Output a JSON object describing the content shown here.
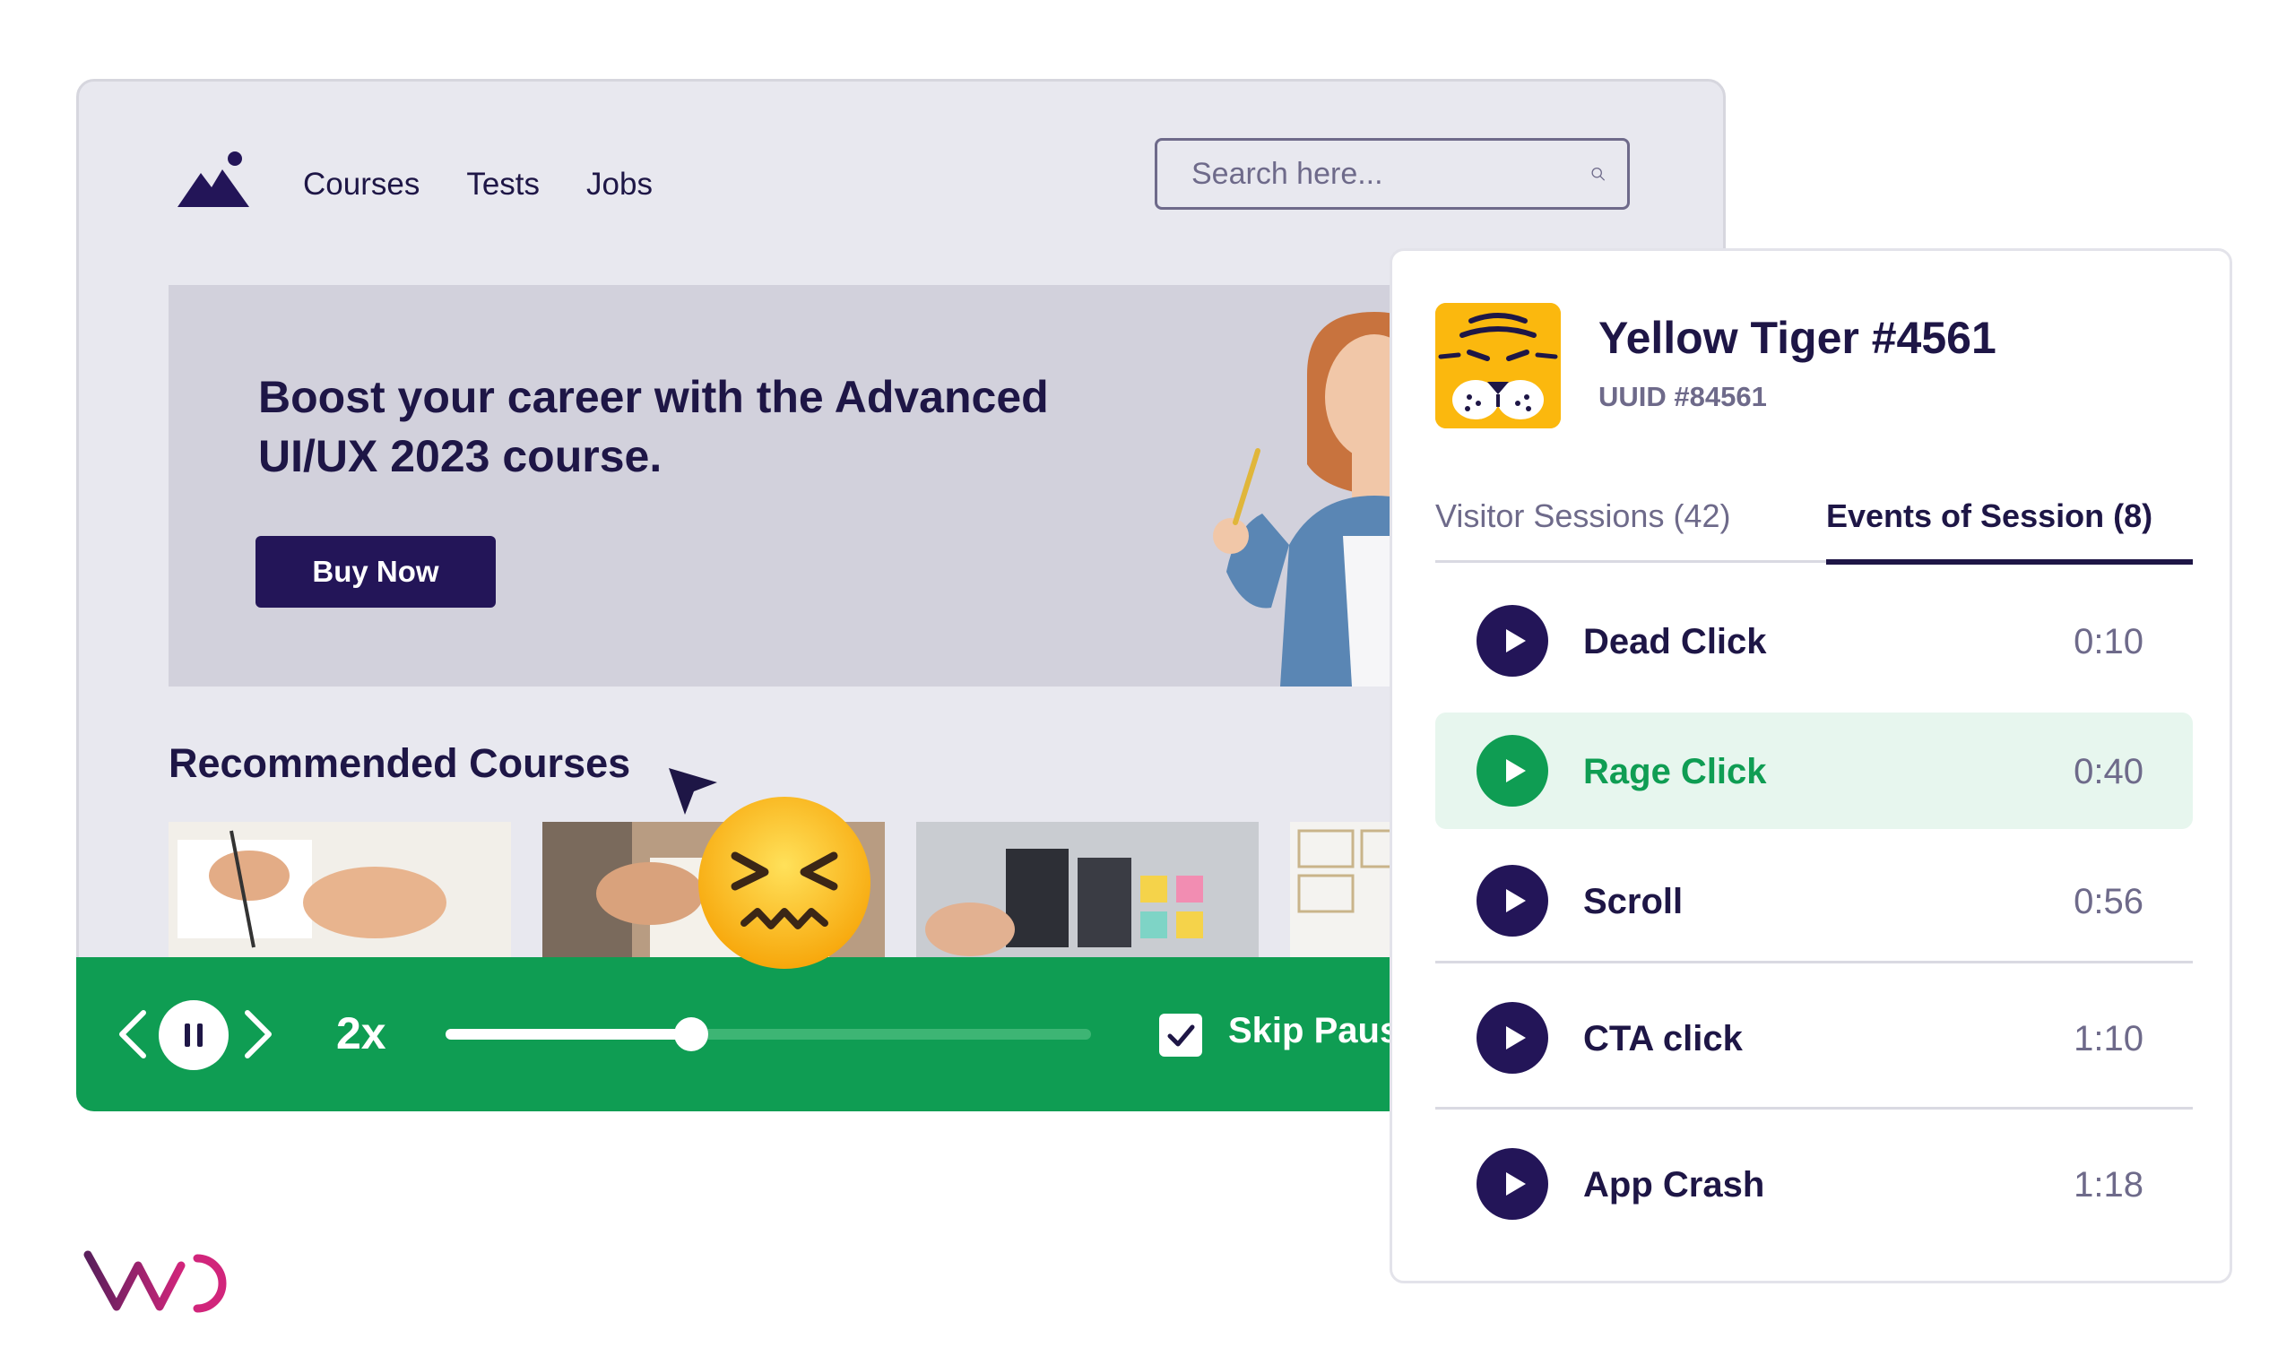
{
  "site": {
    "nav": [
      "Courses",
      "Tests",
      "Jobs"
    ],
    "search_placeholder": "Search here...",
    "hero": {
      "title": "Boost your career with the Advanced UI/UX 2023 course.",
      "cta": "Buy Now"
    },
    "recommended_title": "Recommended Courses"
  },
  "player": {
    "speed": "2x",
    "progress": 0.38,
    "skip_label": "Skip Paus",
    "skip_checked": true
  },
  "panel": {
    "visitor_name": "Yellow Tiger #4561",
    "uuid": "UUID #84561",
    "tabs": [
      "Visitor Sessions (42)",
      "Events of Session (8)"
    ],
    "active_tab": 1,
    "events": [
      {
        "label": "Dead Click",
        "time": "0:10"
      },
      {
        "label": "Rage Click",
        "time": "0:40",
        "active": true
      },
      {
        "label": "Scroll",
        "time": "0:56"
      },
      {
        "label": "CTA click",
        "time": "1:10"
      },
      {
        "label": "App Crash",
        "time": "1:18"
      }
    ]
  },
  "colors": {
    "navy": "#1e1646",
    "button": "#231558",
    "green": "#0f9d53",
    "active_row": "#e7f6ee",
    "tiger": "#fbb80e",
    "brand_purple": "#5a1f5c",
    "brand_pink": "#d1257b"
  },
  "icons": [
    "mountain-logo-icon",
    "search-icon",
    "cursor-icon",
    "confounded-emoji-icon",
    "chevron-left-icon",
    "pause-icon",
    "chevron-right-icon",
    "checkmark-icon",
    "tiger-avatar-icon",
    "play-icon"
  ]
}
